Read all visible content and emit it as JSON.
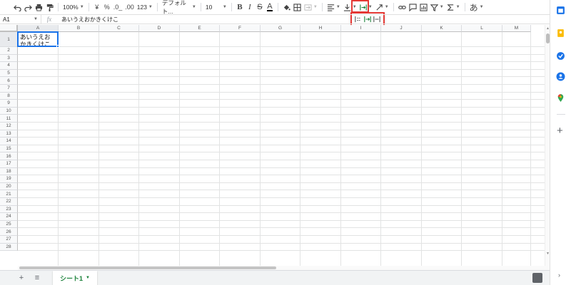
{
  "toolbar": {
    "zoom": "100%",
    "currency": "¥",
    "percent": "%",
    "dec_decrease": ".0_",
    "dec_increase": ".00",
    "format_more": "123",
    "font": "デフォルト...",
    "font_size": "10",
    "bold": "B",
    "italic": "I",
    "strike": "S",
    "text_color": "A",
    "input_tools": "あ"
  },
  "formula_bar": {
    "cell_ref": "A1",
    "fx": "fx",
    "content": "あいうえおかきくけこ"
  },
  "grid": {
    "columns": [
      "A",
      "B",
      "C",
      "D",
      "E",
      "F",
      "G",
      "H",
      "I",
      "J",
      "K",
      "L",
      "M"
    ],
    "rows": [
      "1",
      "2",
      "3",
      "4",
      "5",
      "6",
      "7",
      "8",
      "9",
      "10",
      "11",
      "12",
      "13",
      "14",
      "15",
      "16",
      "17",
      "18",
      "19",
      "20",
      "21",
      "22",
      "23",
      "24",
      "25",
      "26",
      "27",
      "28"
    ],
    "selected_cell": {
      "ref": "A1",
      "value": "あいうえおかきくけこ"
    }
  },
  "sheet": {
    "add_label": "+",
    "menu_label": "≡",
    "tab_name": "シート1"
  },
  "colors": {
    "accent": "#1a73e8",
    "highlight": "#e53935",
    "sheet_tab": "#188038"
  }
}
